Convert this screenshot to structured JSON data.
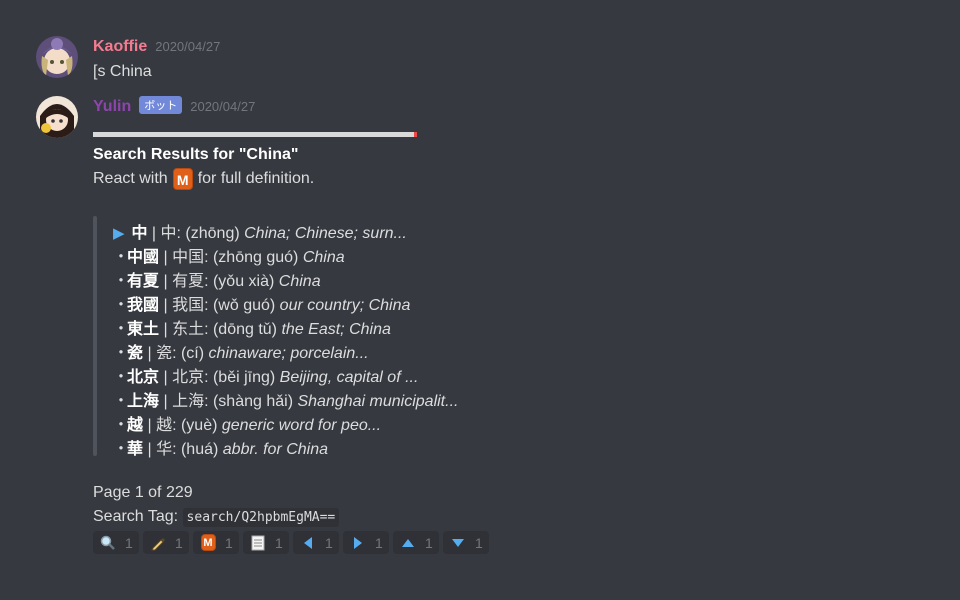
{
  "colors": {
    "background": "#36393f",
    "user_name": "#f47b91",
    "bot_name": "#8e44ad",
    "bot_tag": "#7289da",
    "timestamp": "#72767d"
  },
  "messages": [
    {
      "username": "Kaoffie",
      "timestamp": "2020/04/27",
      "content": "[s China"
    },
    {
      "username": "Yulin",
      "bot_tag": "ボット",
      "timestamp": "2020/04/27",
      "title": "Search Results for \"China\"",
      "react_before": "React with",
      "react_emoji": "M",
      "react_after": "for full definition.",
      "entries": [
        {
          "marker": "▶",
          "trad": "中",
          "simp": "中",
          "pinyin": "(zhōng)",
          "def": "China; Chinese; surn..."
        },
        {
          "marker": "・",
          "trad": "中國",
          "simp": "中国",
          "pinyin": "(zhōng guó)",
          "def": "China"
        },
        {
          "marker": "・",
          "trad": "有夏",
          "simp": "有夏",
          "pinyin": "(yǒu xià)",
          "def": "China"
        },
        {
          "marker": "・",
          "trad": "我國",
          "simp": "我国",
          "pinyin": "(wǒ guó)",
          "def": "our country; China"
        },
        {
          "marker": "・",
          "trad": "東土",
          "simp": "东土",
          "pinyin": "(dōng tǔ)",
          "def": "the East; China"
        },
        {
          "marker": "・",
          "trad": "瓷",
          "simp": "瓷",
          "pinyin": "(cí)",
          "def": "chinaware; porcelain..."
        },
        {
          "marker": "・",
          "trad": "北京",
          "simp": "北京",
          "pinyin": "(běi jīng)",
          "def": "Beijing, capital of ..."
        },
        {
          "marker": "・",
          "trad": "上海",
          "simp": "上海",
          "pinyin": "(shàng hǎi)",
          "def": "Shanghai municipalit..."
        },
        {
          "marker": "・",
          "trad": "越",
          "simp": "越",
          "pinyin": "(yuè)",
          "def": "generic word for peo..."
        },
        {
          "marker": "・",
          "trad": "華",
          "simp": "华",
          "pinyin": "(huá)",
          "def": "abbr. for China"
        }
      ],
      "page": "Page 1 of 229",
      "search_tag_label": "Search Tag:",
      "search_tag": "search/Q2hpbmEgMA=="
    }
  ],
  "reactions": [
    {
      "icon": "magnifier-icon",
      "count": "1"
    },
    {
      "icon": "pen-icon",
      "count": "1"
    },
    {
      "icon": "m-icon",
      "count": "1"
    },
    {
      "icon": "page-icon",
      "count": "1"
    },
    {
      "icon": "arrow-left-icon",
      "count": "1"
    },
    {
      "icon": "arrow-right-icon",
      "count": "1"
    },
    {
      "icon": "arrow-up-icon",
      "count": "1"
    },
    {
      "icon": "arrow-down-icon",
      "count": "1"
    }
  ]
}
